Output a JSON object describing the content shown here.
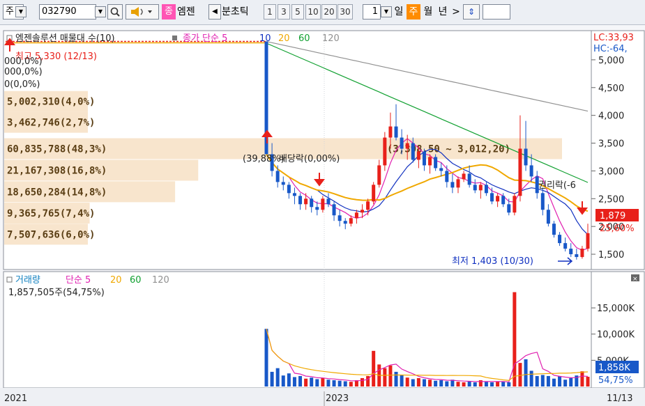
{
  "toolbar": {
    "market": "주",
    "code": "032790",
    "chip": "종",
    "name": "엠젠",
    "term_label": "분초틱",
    "periods": [
      "1",
      "3",
      "5",
      "10",
      "20",
      "30"
    ],
    "count": "1",
    "units": [
      "일",
      "주",
      "월",
      "년"
    ],
    "selected_unit": "주",
    "next": ">",
    "sort": "⇕"
  },
  "price_panel": {
    "title": "엠젠솔루션 매물대 수(10)",
    "ma_label": "종가 단순 5",
    "ma_periods": [
      "10",
      "20",
      "60",
      "120"
    ],
    "lc_label": "LC:33,93",
    "hc_label": "HC:-64,",
    "current_price": "1,879",
    "current_pct": "25,60%",
    "high_label": "최고 5,330 (12/13)",
    "low_label": "최저 1,403 (10/30)",
    "annot_left": "(39,88%)",
    "annot_dividend": "배당락(0,00%)",
    "annot_rights": "권리락(-6",
    "top_codes": [
      "000,0%)",
      "000,0%)",
      "0(0,0%)"
    ]
  },
  "volume_panel": {
    "title": "거래량",
    "ma_label": "단순 5",
    "ma_periods": [
      "20",
      "60",
      "120"
    ],
    "info": "1,857,505주(54,75%)",
    "current_vol": "1,858K",
    "current_pct": "54,75%"
  },
  "xaxis": {
    "labels": [
      "2021",
      "2023"
    ],
    "last_date": "11/13"
  },
  "colors": {
    "up": "#e8201a",
    "down": "#1858c8",
    "ma5": "#e020b0",
    "ma10": "#1030c0",
    "ma20": "#f0a800",
    "ma60": "#10a030",
    "ma120": "#909090",
    "bands": "#f7e2c8"
  },
  "chart_data": {
    "type": "candlestick",
    "title": "엠젠솔루션 매물대 수(10)",
    "y_ticks": [
      1500,
      2000,
      2500,
      3000,
      3500,
      4000,
      4500,
      5000
    ],
    "y_ticks_labels": [
      "1,500",
      "2,000",
      "2,500",
      "3,000",
      "3,500",
      "4,000",
      "4,500",
      "5,000"
    ],
    "ylim": [
      1250,
      5500
    ],
    "volume_ticks": [
      5000,
      10000,
      15000
    ],
    "volume_ticks_labels": [
      "5,000K",
      "10,000K",
      "15,000K"
    ],
    "volume_ylim": [
      0,
      19000
    ],
    "volume_profile": [
      {
        "label": "5,002,310(4,0%)",
        "price": 4250,
        "pct": 4.0
      },
      {
        "label": "3,462,746(2,7%)",
        "price": 3875,
        "pct": 2.7
      },
      {
        "label": "60,835,788(48,3%)",
        "price": 3400,
        "pct": 48.3
      },
      {
        "label": "21,167,308(16,8%)",
        "price": 3012,
        "pct": 16.8
      },
      {
        "label": "18,650,284(14,8%)",
        "price": 2625,
        "pct": 14.8
      },
      {
        "label": "9,365,765(7,4%)",
        "price": 2240,
        "pct": 7.4
      },
      {
        "label": "7,507,636(6,0%)",
        "price": 1860,
        "pct": 6.0
      }
    ],
    "range_note": "(3,398,50 ~ 3,012,20)",
    "ohlc": [
      [
        5330,
        5330,
        3300,
        3300
      ],
      [
        3300,
        3500,
        2900,
        3000
      ],
      [
        3000,
        3100,
        2700,
        2800
      ],
      [
        2800,
        2900,
        2650,
        2750
      ],
      [
        2750,
        2800,
        2500,
        2600
      ],
      [
        2600,
        2700,
        2400,
        2550
      ],
      [
        2550,
        2600,
        2300,
        2400
      ],
      [
        2400,
        2600,
        2300,
        2500
      ],
      [
        2500,
        2550,
        2250,
        2350
      ],
      [
        2350,
        2450,
        2200,
        2300
      ],
      [
        2300,
        2550,
        2250,
        2500
      ],
      [
        2500,
        2600,
        2350,
        2400
      ],
      [
        2400,
        2450,
        2100,
        2200
      ],
      [
        2200,
        2300,
        2000,
        2100
      ],
      [
        2100,
        2150,
        1950,
        2050
      ],
      [
        2050,
        2200,
        2000,
        2150
      ],
      [
        2150,
        2300,
        2050,
        2250
      ],
      [
        2250,
        2400,
        2150,
        2300
      ],
      [
        2300,
        2500,
        2200,
        2450
      ],
      [
        2450,
        2800,
        2400,
        2750
      ],
      [
        2750,
        3200,
        2700,
        3100
      ],
      [
        3100,
        3700,
        3000,
        3600
      ],
      [
        3600,
        4050,
        3400,
        3800
      ],
      [
        3800,
        4200,
        3550,
        3600
      ],
      [
        3600,
        3750,
        3300,
        3400
      ],
      [
        3400,
        3650,
        3200,
        3500
      ],
      [
        3500,
        3600,
        3150,
        3200
      ],
      [
        3200,
        3450,
        3050,
        3350
      ],
      [
        3350,
        3400,
        3000,
        3100
      ],
      [
        3100,
        3300,
        2950,
        3250
      ],
      [
        3250,
        3300,
        3000,
        3050
      ],
      [
        3050,
        3150,
        2900,
        3000
      ],
      [
        3000,
        3100,
        2700,
        2800
      ],
      [
        2800,
        2950,
        2600,
        2700
      ],
      [
        2700,
        2900,
        2600,
        2850
      ],
      [
        2850,
        3000,
        2800,
        2950
      ],
      [
        2950,
        3100,
        2700,
        2750
      ],
      [
        2750,
        2850,
        2600,
        2650
      ],
      [
        2650,
        2800,
        2500,
        2750
      ],
      [
        2750,
        2800,
        2550,
        2600
      ],
      [
        2600,
        2700,
        2400,
        2450
      ],
      [
        2450,
        2600,
        2350,
        2550
      ],
      [
        2550,
        2600,
        2350,
        2400
      ],
      [
        2400,
        2500,
        2200,
        2250
      ],
      [
        2250,
        2600,
        2200,
        2550
      ],
      [
        2550,
        4000,
        2450,
        3400
      ],
      [
        3400,
        3900,
        3000,
        3100
      ],
      [
        3100,
        3300,
        2800,
        2900
      ],
      [
        2900,
        3000,
        2500,
        2600
      ],
      [
        2600,
        2700,
        2200,
        2300
      ],
      [
        2300,
        2400,
        2000,
        2050
      ],
      [
        2050,
        2100,
        1800,
        1850
      ],
      [
        1850,
        1900,
        1650,
        1700
      ],
      [
        1700,
        1800,
        1550,
        1600
      ],
      [
        1600,
        1700,
        1450,
        1500
      ],
      [
        1500,
        1600,
        1403,
        1450
      ],
      [
        1450,
        1650,
        1420,
        1600
      ],
      [
        1600,
        2050,
        1550,
        1879
      ]
    ],
    "volume": [
      11000,
      2800,
      3500,
      2100,
      2500,
      1800,
      2000,
      1500,
      1700,
      1400,
      1600,
      1300,
      1200,
      1100,
      1000,
      900,
      1200,
      1600,
      2000,
      6800,
      4200,
      3500,
      4000,
      2800,
      2200,
      1700,
      1400,
      1600,
      1400,
      1300,
      1100,
      1200,
      1000,
      1300,
      900,
      800,
      1000,
      800,
      1200,
      900,
      800,
      1000,
      900,
      800,
      18000,
      4500,
      5200,
      3000,
      2000,
      2200,
      2000,
      1500,
      2000,
      1300,
      1600,
      2100,
      2900,
      1858
    ]
  }
}
